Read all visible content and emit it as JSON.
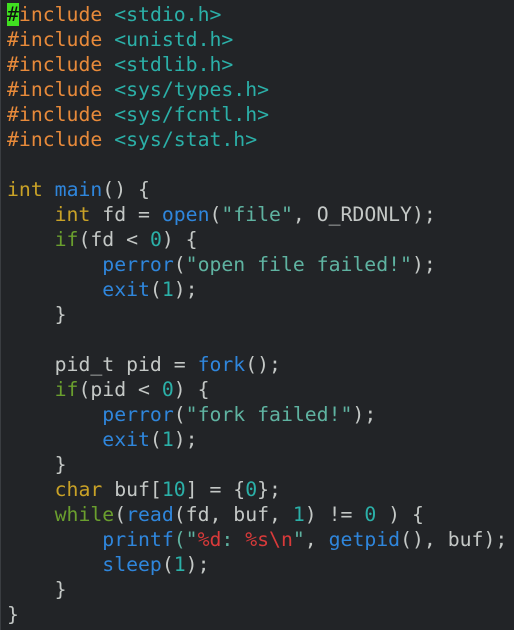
{
  "editor": {
    "colors": {
      "background": "#222427",
      "default": "#c4c8c6",
      "preproc": "#e88a3a",
      "header": "#2bb0a8",
      "type": "#c9a227",
      "func": "#2f86dc",
      "string": "#5fb3a1",
      "number": "#2bb0a8",
      "keyword": "#6a9f2e",
      "format": "#d93a3a",
      "cursor": "#40e020"
    },
    "cursor": {
      "line": 0,
      "token": 0
    },
    "lines": [
      [
        {
          "t": "#",
          "c": "preproc"
        },
        {
          "t": "include",
          "c": "preproc"
        },
        {
          "t": " ",
          "c": "default"
        },
        {
          "t": "<stdio.h>",
          "c": "header"
        }
      ],
      [
        {
          "t": "#include",
          "c": "preproc"
        },
        {
          "t": " ",
          "c": "default"
        },
        {
          "t": "<unistd.h>",
          "c": "header"
        }
      ],
      [
        {
          "t": "#include",
          "c": "preproc"
        },
        {
          "t": " ",
          "c": "default"
        },
        {
          "t": "<stdlib.h>",
          "c": "header"
        }
      ],
      [
        {
          "t": "#include",
          "c": "preproc"
        },
        {
          "t": " ",
          "c": "default"
        },
        {
          "t": "<sys/types.h>",
          "c": "header"
        }
      ],
      [
        {
          "t": "#include",
          "c": "preproc"
        },
        {
          "t": " ",
          "c": "default"
        },
        {
          "t": "<sys/fcntl.h>",
          "c": "header"
        }
      ],
      [
        {
          "t": "#include",
          "c": "preproc"
        },
        {
          "t": " ",
          "c": "default"
        },
        {
          "t": "<sys/stat.h>",
          "c": "header"
        }
      ],
      [],
      [
        {
          "t": "int",
          "c": "type"
        },
        {
          "t": " ",
          "c": "default"
        },
        {
          "t": "main",
          "c": "func"
        },
        {
          "t": "() {",
          "c": "default"
        }
      ],
      [
        {
          "t": "    ",
          "c": "default"
        },
        {
          "t": "int",
          "c": "type"
        },
        {
          "t": " fd = ",
          "c": "default"
        },
        {
          "t": "open",
          "c": "func"
        },
        {
          "t": "(",
          "c": "default"
        },
        {
          "t": "\"file\"",
          "c": "string"
        },
        {
          "t": ", O_RDONLY);",
          "c": "default"
        }
      ],
      [
        {
          "t": "    ",
          "c": "default"
        },
        {
          "t": "if",
          "c": "keyword"
        },
        {
          "t": "(fd < ",
          "c": "default"
        },
        {
          "t": "0",
          "c": "number"
        },
        {
          "t": ") {",
          "c": "default"
        }
      ],
      [
        {
          "t": "        ",
          "c": "default"
        },
        {
          "t": "perror",
          "c": "func"
        },
        {
          "t": "(",
          "c": "default"
        },
        {
          "t": "\"open file failed!\"",
          "c": "string"
        },
        {
          "t": ");",
          "c": "default"
        }
      ],
      [
        {
          "t": "        ",
          "c": "default"
        },
        {
          "t": "exit",
          "c": "func"
        },
        {
          "t": "(",
          "c": "default"
        },
        {
          "t": "1",
          "c": "number"
        },
        {
          "t": ");",
          "c": "default"
        }
      ],
      [
        {
          "t": "    }",
          "c": "default"
        }
      ],
      [],
      [
        {
          "t": "    pid_t pid = ",
          "c": "default"
        },
        {
          "t": "fork",
          "c": "func"
        },
        {
          "t": "();",
          "c": "default"
        }
      ],
      [
        {
          "t": "    ",
          "c": "default"
        },
        {
          "t": "if",
          "c": "keyword"
        },
        {
          "t": "(pid < ",
          "c": "default"
        },
        {
          "t": "0",
          "c": "number"
        },
        {
          "t": ") {",
          "c": "default"
        }
      ],
      [
        {
          "t": "        ",
          "c": "default"
        },
        {
          "t": "perror",
          "c": "func"
        },
        {
          "t": "(",
          "c": "default"
        },
        {
          "t": "\"fork failed!\"",
          "c": "string"
        },
        {
          "t": ");",
          "c": "default"
        }
      ],
      [
        {
          "t": "        ",
          "c": "default"
        },
        {
          "t": "exit",
          "c": "func"
        },
        {
          "t": "(",
          "c": "default"
        },
        {
          "t": "1",
          "c": "number"
        },
        {
          "t": ");",
          "c": "default"
        }
      ],
      [
        {
          "t": "    }",
          "c": "default"
        }
      ],
      [
        {
          "t": "    ",
          "c": "default"
        },
        {
          "t": "char",
          "c": "type"
        },
        {
          "t": " buf[",
          "c": "default"
        },
        {
          "t": "10",
          "c": "number"
        },
        {
          "t": "] = {",
          "c": "default"
        },
        {
          "t": "0",
          "c": "number"
        },
        {
          "t": "};",
          "c": "default"
        }
      ],
      [
        {
          "t": "    ",
          "c": "default"
        },
        {
          "t": "while",
          "c": "keyword"
        },
        {
          "t": "(",
          "c": "default"
        },
        {
          "t": "read",
          "c": "func"
        },
        {
          "t": "(fd, buf, ",
          "c": "default"
        },
        {
          "t": "1",
          "c": "number"
        },
        {
          "t": ") != ",
          "c": "default"
        },
        {
          "t": "0",
          "c": "number"
        },
        {
          "t": " ) {",
          "c": "default"
        }
      ],
      [
        {
          "t": "        ",
          "c": "default"
        },
        {
          "t": "printf",
          "c": "func"
        },
        {
          "t": "(\"",
          "c": "string"
        },
        {
          "t": "%d",
          "c": "format"
        },
        {
          "t": ": ",
          "c": "string"
        },
        {
          "t": "%s\\n",
          "c": "format"
        },
        {
          "t": "\"",
          "c": "string"
        },
        {
          "t": ", ",
          "c": "default"
        },
        {
          "t": "getpid",
          "c": "func"
        },
        {
          "t": "(), buf);",
          "c": "default"
        }
      ],
      [
        {
          "t": "        ",
          "c": "default"
        },
        {
          "t": "sleep",
          "c": "func"
        },
        {
          "t": "(",
          "c": "default"
        },
        {
          "t": "1",
          "c": "number"
        },
        {
          "t": ");",
          "c": "default"
        }
      ],
      [
        {
          "t": "    }",
          "c": "default"
        }
      ],
      [
        {
          "t": "}",
          "c": "default"
        }
      ]
    ]
  }
}
